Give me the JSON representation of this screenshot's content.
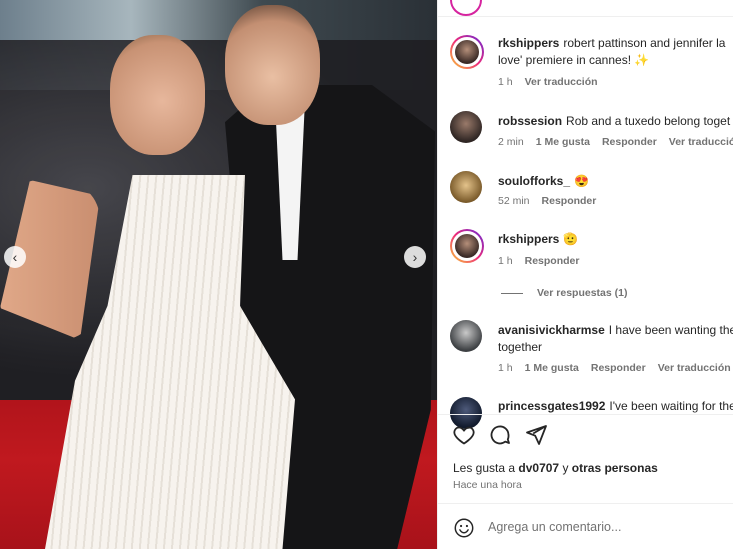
{
  "post": {
    "navigation": {
      "prev_glyph": "‹",
      "next_glyph": "›"
    }
  },
  "comments": [
    {
      "username": "rkshippers",
      "text": "robert pattinson and jennifer la love' premiere in cannes! ✨",
      "time": "1 h",
      "likes": "",
      "see_translation": "Ver traducción",
      "reply": ""
    },
    {
      "username": "robssesion",
      "text": "Rob and a tuxedo belong toget",
      "time": "2 min",
      "likes": "1 Me gusta",
      "reply": "Responder",
      "see_translation": "Ver traducción"
    },
    {
      "username": "soulofforks_",
      "text": "😍",
      "time": "52 min",
      "reply": "Responder"
    },
    {
      "username": "rkshippers",
      "text": "🫡",
      "time": "1 h",
      "reply": "Responder",
      "view_replies": "Ver respuestas (1)"
    },
    {
      "username": "avanisivickharmse",
      "text": "I have been wanting the together",
      "time": "1 h",
      "likes": "1 Me gusta",
      "reply": "Responder",
      "see_translation": "Ver traducción"
    },
    {
      "username": "princessgates1992",
      "text": "I've been waiting for the"
    }
  ],
  "actions": {
    "liked_by_prefix": "Les gusta a",
    "liked_by_user": "dv0707",
    "liked_by_conj": "y",
    "liked_by_others": "otras personas",
    "timestamp": "Hace una hora"
  },
  "comment_box": {
    "placeholder": "Agrega un comentario..."
  },
  "colors": {
    "accent_ring": "#ee2a7b",
    "meta": "#737373",
    "text": "#262626"
  }
}
